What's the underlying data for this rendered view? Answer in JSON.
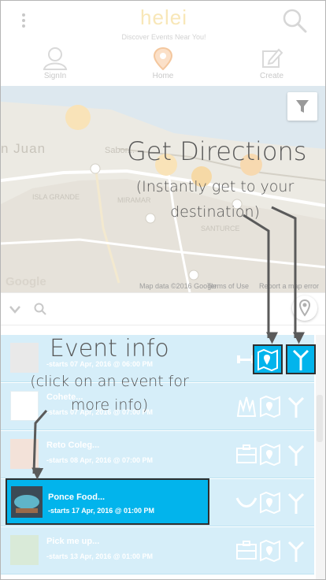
{
  "header": {
    "title": "helei",
    "subtitle": "Discover Events Near You!",
    "nav": [
      {
        "label": "SignIn",
        "icon": "user-icon"
      },
      {
        "label": "Home",
        "icon": "location-pin-icon"
      },
      {
        "label": "Create",
        "icon": "edit-icon"
      }
    ]
  },
  "map": {
    "labels": {
      "city": "n Juan",
      "sabor": "Sabor...",
      "isla": "ISLA GRANDE",
      "miramar": "MIRAMAR",
      "santurce": "SANTURCE"
    },
    "footer": {
      "data": "Map data ©2016 Google",
      "terms": "Terms of Use",
      "report": "Report a map error"
    },
    "google": "Google"
  },
  "annotations": {
    "directions_title": "Get Directions",
    "directions_text": "(Instantly get to your destination)",
    "event_title": "Event info",
    "event_text": "(click on an event for more info)"
  },
  "events": [
    {
      "title": "",
      "sub": "-starts 07 Apr, 2016 @ 06:00 PM"
    },
    {
      "title": "Cohete...",
      "sub": "-starts 07 Apr, 2016 @ 07:00 PM"
    },
    {
      "title": "Reto Coleg...",
      "sub": "-starts 08 Apr, 2016 @ 07:00 PM"
    },
    {
      "title": "Ponce Food...",
      "sub": "-starts 17 Apr, 2016 @ 01:00 PM"
    },
    {
      "title": "Pick me up...",
      "sub": "-starts 13 Apr, 2016 @ 01:00 PM"
    }
  ],
  "colors": {
    "accent": "#02b4ec",
    "row": "#d6eef9",
    "annotation": "#575757",
    "border": "#2f2f2f"
  }
}
